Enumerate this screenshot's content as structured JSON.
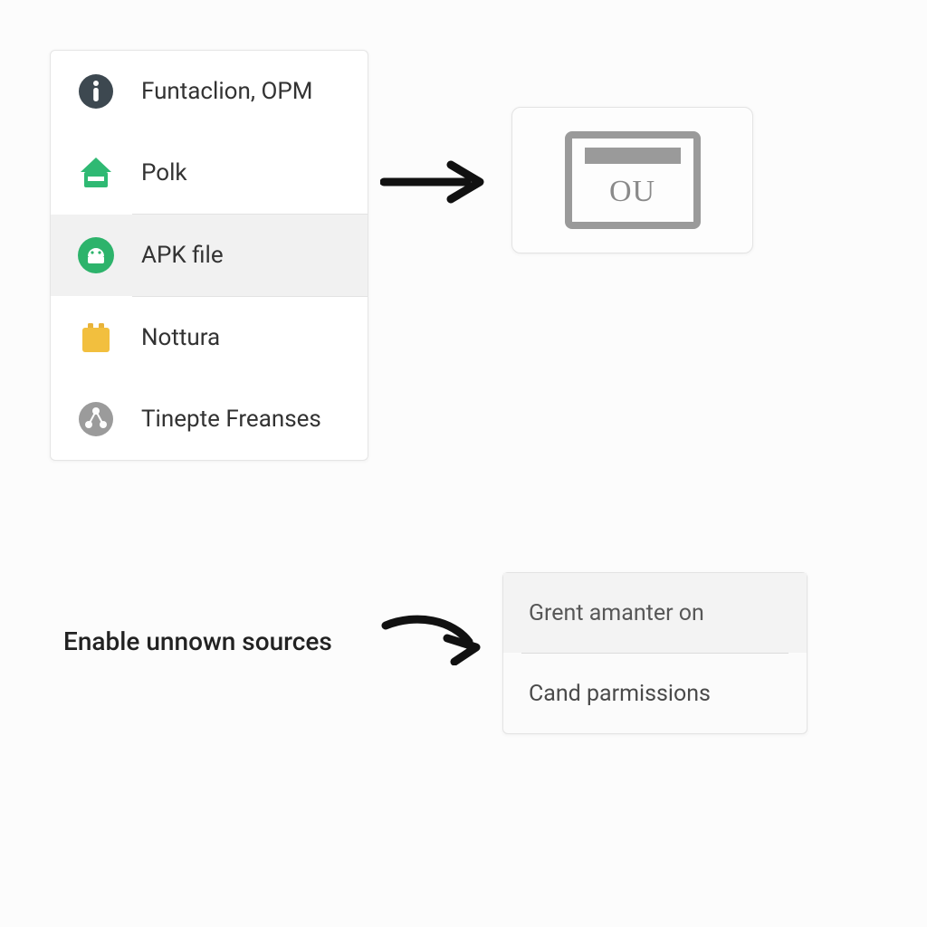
{
  "menu": {
    "items": [
      {
        "label": "Funtaclion, OPM",
        "icon": "info-circle-icon"
      },
      {
        "label": "Polk",
        "icon": "home-green-icon"
      },
      {
        "label": "APK file",
        "icon": "android-circle-icon",
        "selected": true
      },
      {
        "label": "Nottura",
        "icon": "folder-orange-icon"
      },
      {
        "label": "Tinepte Freanses",
        "icon": "nodes-circle-icon"
      }
    ]
  },
  "result_card": {
    "label": "OU"
  },
  "enable_text": "Enable unnown sources",
  "permissions": {
    "items": [
      {
        "label": "Grent amanter on"
      },
      {
        "label": "Cand parmissions"
      }
    ]
  }
}
